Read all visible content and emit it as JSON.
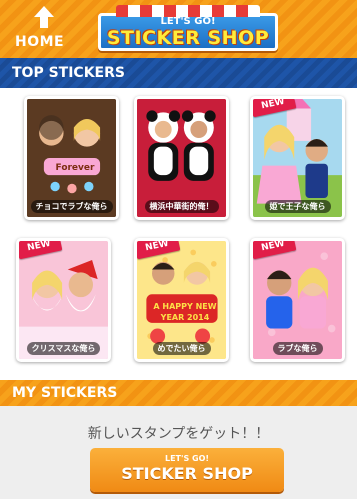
{
  "header": {
    "home_label": "HOME",
    "logo_top": "LET'S GO!",
    "logo_main": "STICKER SHOP"
  },
  "sections": {
    "top_stickers": "TOP STICKERS",
    "my_stickers": "MY STICKERS"
  },
  "stickers": [
    {
      "caption": "チョコでラブな俺ら",
      "new": false,
      "art_text": "Forever"
    },
    {
      "caption": "横浜中華街的俺！",
      "new": false,
      "art_text": ""
    },
    {
      "caption": "姫で王子な俺ら",
      "new": true,
      "art_text": ""
    },
    {
      "caption": "クリスマスな俺ら",
      "new": true,
      "art_text": ""
    },
    {
      "caption": "めでたい俺ら",
      "new": true,
      "art_text": "A HAPPY NEW YEAR 2014"
    },
    {
      "caption": "ラブな俺ら",
      "new": true,
      "art_text": ""
    }
  ],
  "ribbon_label": "NEW",
  "my_stickers": {
    "promo_text": "新しいスタンプをゲット！！",
    "button_top": "LET'S GO!",
    "button_main": "STICKER SHOP"
  },
  "colors": {
    "header_orange": "#f7a21b",
    "section_blue": "#1e55a8",
    "ribbon_red": "#e11d48"
  }
}
